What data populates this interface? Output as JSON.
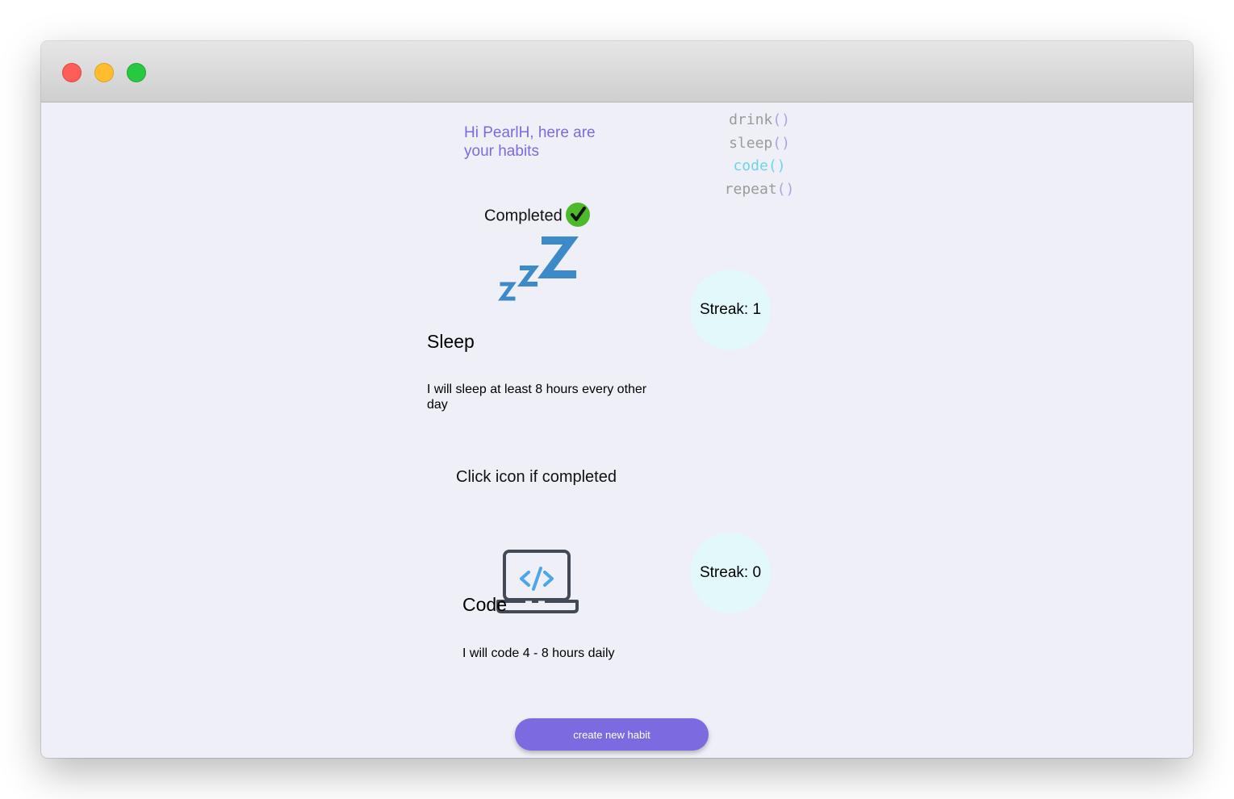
{
  "window": {
    "controls": [
      "close",
      "minimize",
      "maximize"
    ]
  },
  "header": {
    "greeting": "Hi PearlH, here are your habits"
  },
  "code_list": [
    {
      "word": "drink",
      "parens": "()"
    },
    {
      "word": "sleep",
      "parens": "()"
    },
    {
      "word": "code",
      "parens": "()"
    },
    {
      "word": "repeat",
      "parens": "()"
    }
  ],
  "habits": [
    {
      "status": "Completed",
      "completed": true,
      "icon": "zzz-sleep-icon",
      "title": "Sleep",
      "description": "I will sleep at least 8 hours every other day",
      "streak_label": "Streak: 1"
    },
    {
      "status": "Click icon if completed",
      "completed": false,
      "icon": "laptop-code-icon",
      "title": "Code",
      "description": "I will code 4 - 8 hours daily",
      "streak_label": "Streak: 0"
    }
  ],
  "actions": {
    "create_label": "create new habit"
  },
  "colors": {
    "accent": "#7c6be0",
    "streak_bg": "#e2f8fb",
    "check_green": "#4cba2a",
    "sleep_icon": "#3d8ac9",
    "code_highlight": "#6fd3e8"
  }
}
